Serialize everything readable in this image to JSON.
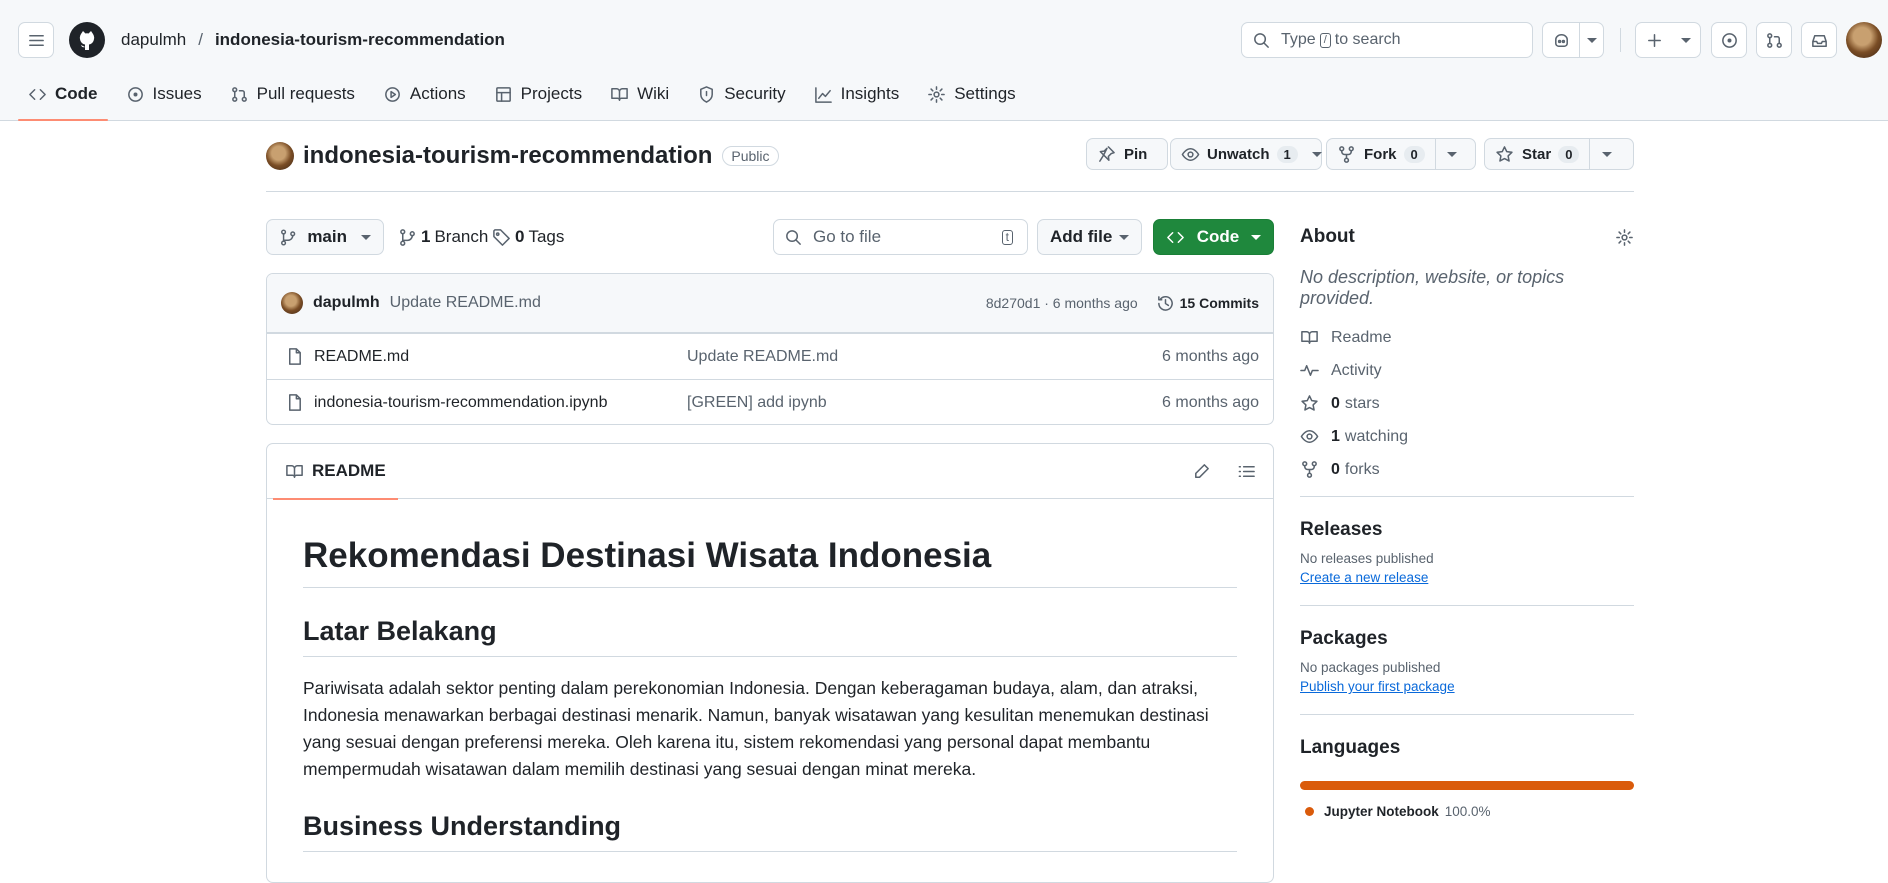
{
  "header": {
    "owner": "dapulmh",
    "separator": "/",
    "repo": "indonesia-tourism-recommendation",
    "search_prefix": "Type",
    "search_key": "/",
    "search_suffix": "to search"
  },
  "tabs": [
    {
      "label": "Code",
      "icon": "code-icon",
      "active": true
    },
    {
      "label": "Issues",
      "icon": "issue-icon"
    },
    {
      "label": "Pull requests",
      "icon": "pull-request-icon"
    },
    {
      "label": "Actions",
      "icon": "play-icon"
    },
    {
      "label": "Projects",
      "icon": "table-icon"
    },
    {
      "label": "Wiki",
      "icon": "book-icon"
    },
    {
      "label": "Security",
      "icon": "shield-icon"
    },
    {
      "label": "Insights",
      "icon": "graph-icon"
    },
    {
      "label": "Settings",
      "icon": "gear-icon"
    }
  ],
  "repo_header": {
    "name": "indonesia-tourism-recommendation",
    "visibility": "Public",
    "pin": "Pin",
    "unwatch": "Unwatch",
    "watch_count": "1",
    "fork": "Fork",
    "fork_count": "0",
    "star": "Star",
    "star_count": "0"
  },
  "branch_bar": {
    "branch": "main",
    "branches_count": "1",
    "branches_label": "Branch",
    "tags_count": "0",
    "tags_label": "Tags",
    "goto_placeholder": "Go to file",
    "goto_key": "t",
    "add_file": "Add file",
    "code": "Code"
  },
  "commit": {
    "author": "dapulmh",
    "message": "Update README.md",
    "meta": "8d270d1 · 6 months ago",
    "commits": "15 Commits"
  },
  "files": [
    {
      "name": "README.md",
      "message": "Update README.md",
      "time": "6 months ago"
    },
    {
      "name": "indonesia-tourism-recommendation.ipynb",
      "message": "[GREEN] add ipynb",
      "time": "6 months ago"
    }
  ],
  "readme": {
    "tab": "README",
    "h1": "Rekomendasi Destinasi Wisata Indonesia",
    "h2a": "Latar Belakang",
    "para": "Pariwisata adalah sektor penting dalam perekonomian Indonesia. Dengan keberagaman budaya, alam, dan atraksi, Indonesia menawarkan berbagai destinasi menarik. Namun, banyak wisatawan yang kesulitan menemukan destinasi yang sesuai dengan preferensi mereka. Oleh karena itu, sistem rekomendasi yang personal dapat membantu mempermudah wisatawan dalam memilih destinasi yang sesuai dengan minat mereka.",
    "h2b": "Business Understanding"
  },
  "about": {
    "title": "About",
    "description": "No description, website, or topics provided.",
    "readme": "Readme",
    "activity": "Activity",
    "stars_count": "0",
    "stars_label": "stars",
    "watching_count": "1",
    "watching_label": "watching",
    "forks_count": "0",
    "forks_label": "forks"
  },
  "releases": {
    "title": "Releases",
    "text": "No releases published",
    "link": "Create a new release"
  },
  "packages": {
    "title": "Packages",
    "text": "No packages published",
    "link": "Publish your first package"
  },
  "languages": {
    "title": "Languages",
    "name": "Jupyter Notebook",
    "percent": "100.0%",
    "value": 100,
    "color": "#da5b0b"
  }
}
